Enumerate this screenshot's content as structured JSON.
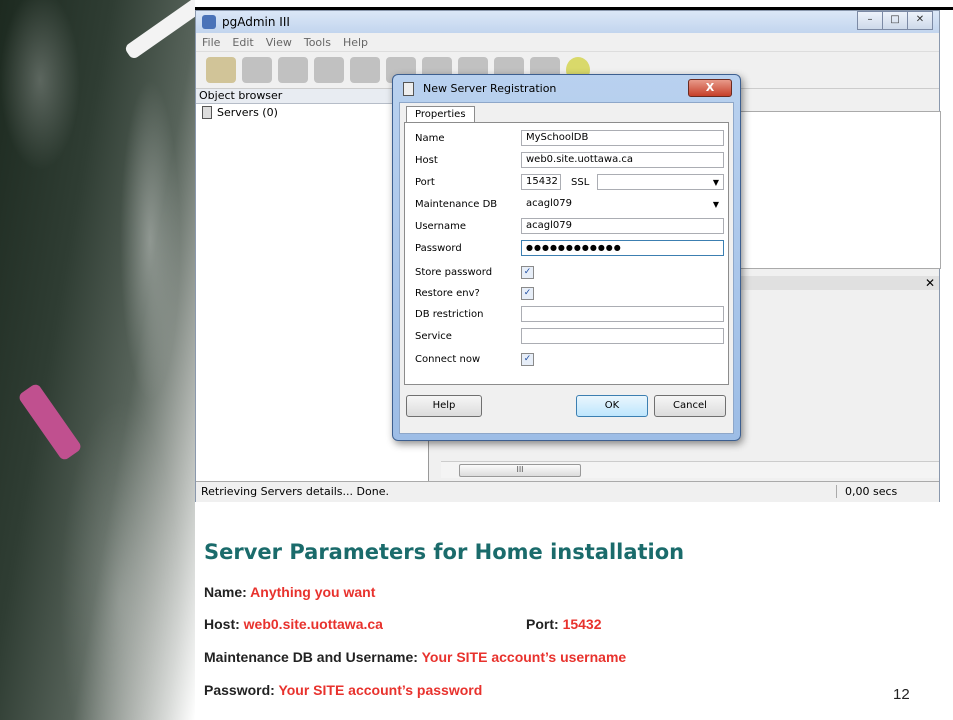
{
  "app": {
    "title": "pgAdmin III",
    "window_buttons": [
      "–",
      "□",
      "✕"
    ],
    "menu": [
      "File",
      "Edit",
      "View",
      "Tools",
      "Help"
    ],
    "object_browser_label": "Object browser",
    "tree_root": "Servers (0)",
    "status_text": "Retrieving Servers details... Done.",
    "status_time": "0,00 secs",
    "scroll_thumb": "III"
  },
  "dialog": {
    "title": "New Server Registration",
    "close_label": "X",
    "tab": "Properties",
    "fields": {
      "name": {
        "label": "Name",
        "value": "MySchoolDB"
      },
      "host": {
        "label": "Host",
        "value": "web0.site.uottawa.ca"
      },
      "port": {
        "label": "Port",
        "value": "15432"
      },
      "ssl": {
        "label": "SSL",
        "value": ""
      },
      "maintenance_db": {
        "label": "Maintenance DB",
        "value": "acagl079"
      },
      "username": {
        "label": "Username",
        "value": "acagl079"
      },
      "password": {
        "label": "Password",
        "value": "●●●●●●●●●●●●"
      },
      "store_password": {
        "label": "Store password",
        "checked": true
      },
      "restore_env": {
        "label": "Restore env?",
        "checked": true
      },
      "db_restriction": {
        "label": "DB restriction",
        "value": ""
      },
      "service": {
        "label": "Service",
        "value": ""
      },
      "connect_now": {
        "label": "Connect now",
        "checked": true
      }
    },
    "buttons": {
      "help": "Help",
      "ok": "OK",
      "cancel": "Cancel"
    }
  },
  "slide": {
    "title": "Server Parameters for Home installation",
    "name_label": "Name: ",
    "name_value": "Anything you want",
    "host_label": "Host: ",
    "host_value": "web0.site.uottawa.ca",
    "port_label": "Port: ",
    "port_value": "15432",
    "maint_label": "Maintenance DB and Username: ",
    "maint_value": "Your SITE account’s username",
    "password_label": "Password: ",
    "password_value": "Your SITE account’s password",
    "page_number": "12"
  },
  "colors": {
    "title": "#1a6b6b",
    "highlight": "#e8322d"
  }
}
